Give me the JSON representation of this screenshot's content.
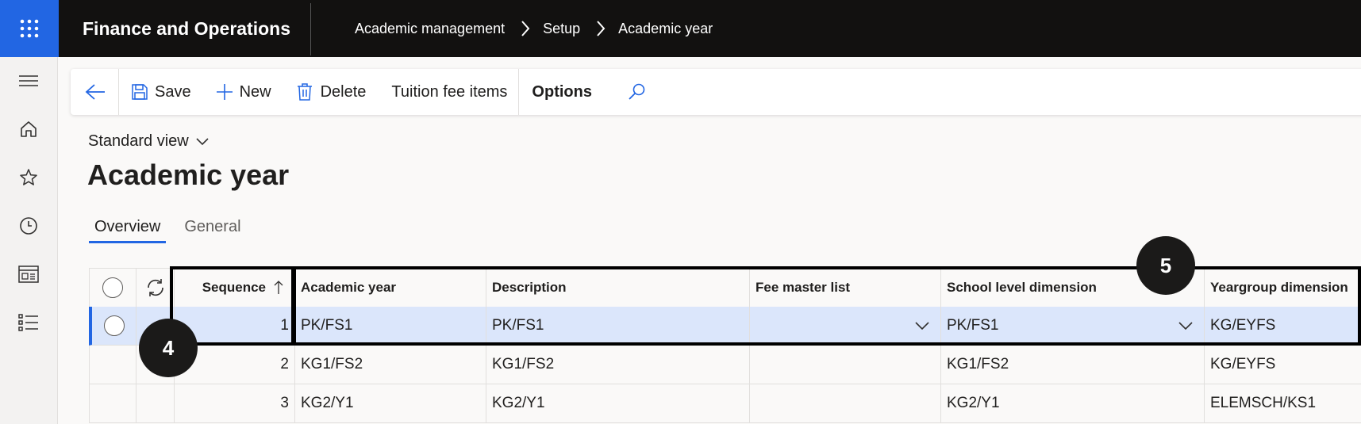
{
  "app": {
    "title": "Finance and Operations"
  },
  "breadcrumb": [
    "Academic management",
    "Setup",
    "Academic year"
  ],
  "actions": {
    "save": "Save",
    "new": "New",
    "delete": "Delete",
    "tuition": "Tuition fee items",
    "options": "Options"
  },
  "view": {
    "label": "Standard view"
  },
  "page": {
    "title": "Academic year"
  },
  "tabs": {
    "overview": "Overview",
    "general": "General"
  },
  "grid": {
    "headers": [
      "Sequence",
      "Academic year",
      "Description",
      "Fee master list",
      "School level dimension",
      "Yeargroup dimension"
    ],
    "rows": [
      {
        "seq": "1",
        "year": "PK/FS1",
        "desc": "PK/FS1",
        "fee": "",
        "school": "PK/FS1",
        "yeargroup": "KG/EYFS"
      },
      {
        "seq": "2",
        "year": "KG1/FS2",
        "desc": "KG1/FS2",
        "fee": "",
        "school": "KG1/FS2",
        "yeargroup": "KG/EYFS"
      },
      {
        "seq": "3",
        "year": "KG2/Y1",
        "desc": "KG2/Y1",
        "fee": "",
        "school": "KG2/Y1",
        "yeargroup": "ELEMSCH/KS1"
      }
    ]
  },
  "callouts": {
    "a": "4",
    "b": "5"
  },
  "colors": {
    "accent": "#2266e3",
    "topbar": "#121110",
    "selected_row": "#dbe6fb"
  }
}
